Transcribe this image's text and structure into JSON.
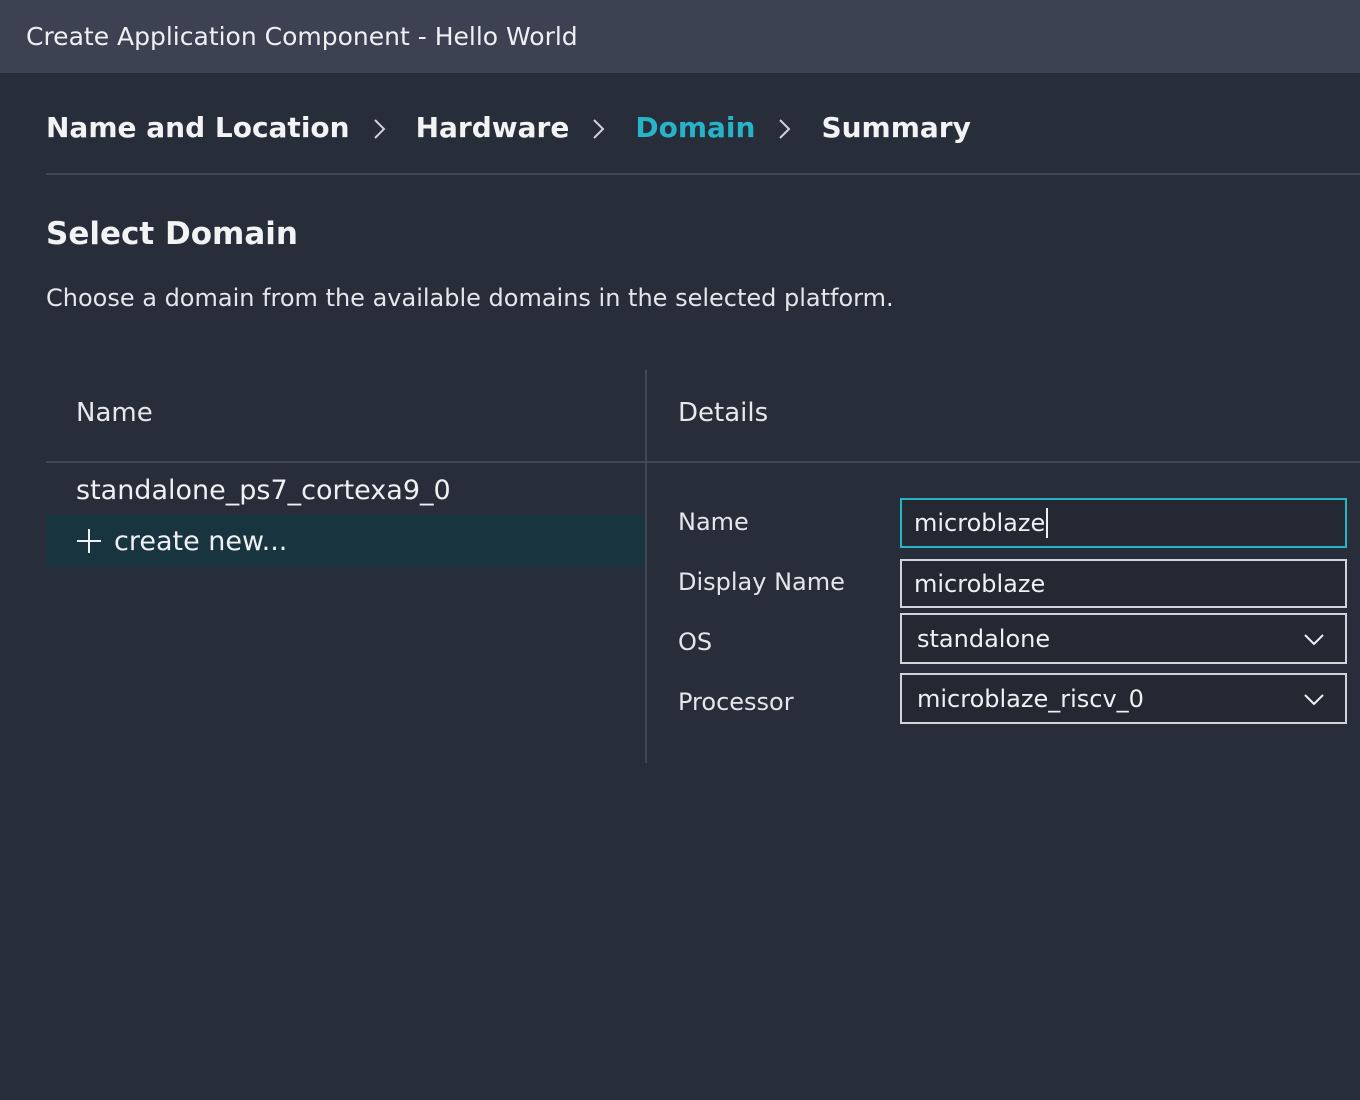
{
  "window": {
    "title": "Create Application Component - Hello World"
  },
  "wizard": {
    "steps": [
      {
        "label": "Name and Location",
        "active": false
      },
      {
        "label": "Hardware",
        "active": false
      },
      {
        "label": "Domain",
        "active": true
      },
      {
        "label": "Summary",
        "active": false
      }
    ]
  },
  "section": {
    "title": "Select Domain",
    "description": "Choose a domain from the available domains in the selected platform."
  },
  "domain_list": {
    "header": "Name",
    "items": [
      {
        "label": "standalone_ps7_cortexa9_0"
      },
      {
        "label": "create new...",
        "icon": "plus-icon",
        "selected": true
      }
    ]
  },
  "details": {
    "header": "Details",
    "name_label": "Name",
    "name_value": "microblaze",
    "display_name_label": "Display Name",
    "display_name_value": "microblaze",
    "os_label": "OS",
    "os_value": "standalone",
    "processor_label": "Processor",
    "processor_value": "microblaze_riscv_0"
  },
  "colors": {
    "accent": "#27b4c8",
    "background": "#282d3a",
    "titlebar": "#3c4252",
    "selected_row": "#18343f"
  }
}
